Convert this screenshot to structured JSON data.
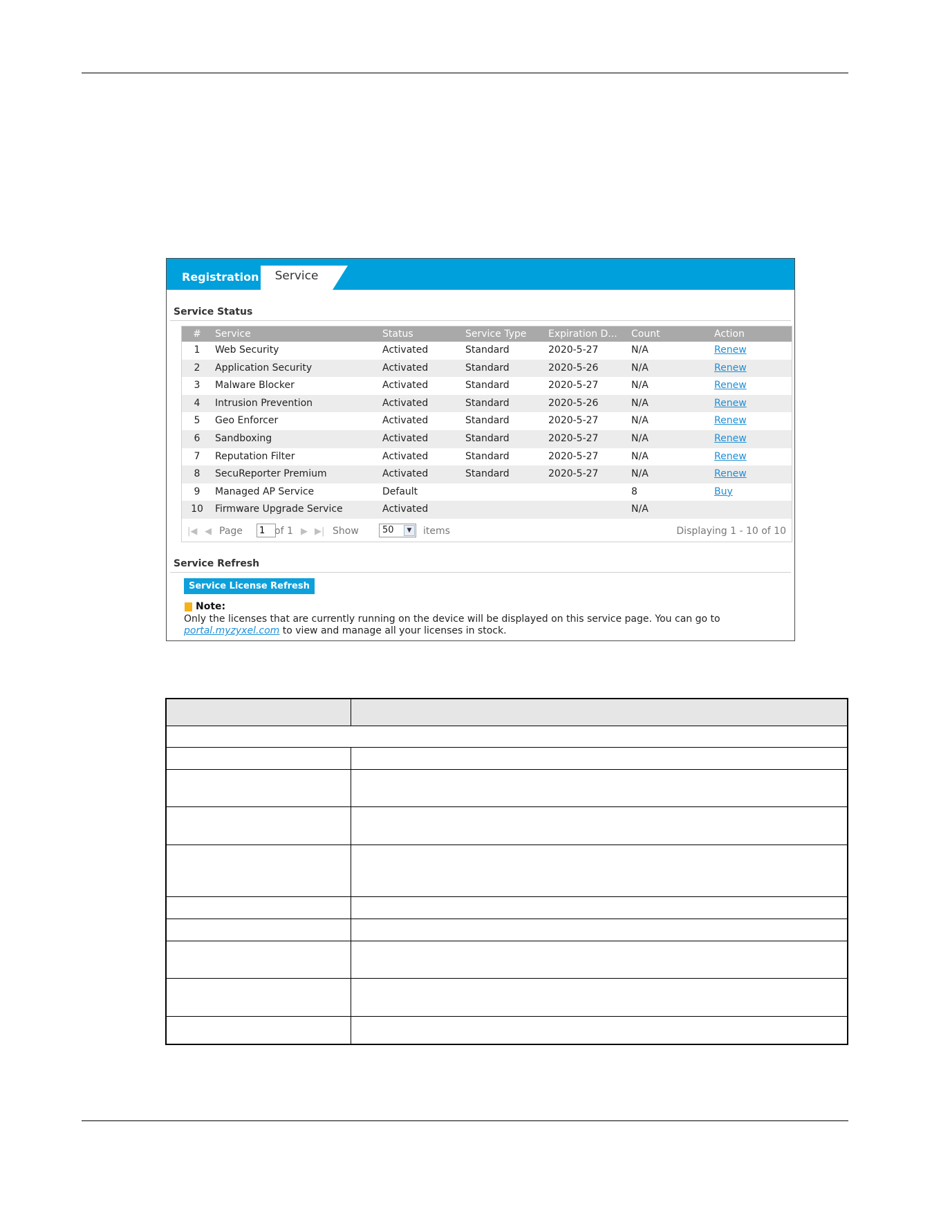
{
  "tabs": [
    {
      "label": "Registration"
    },
    {
      "label": "Service"
    }
  ],
  "service_status": {
    "title": "Service Status",
    "columns": [
      "#",
      "Service",
      "Status",
      "Service Type",
      "Expiration D...",
      "Count",
      "Action"
    ],
    "rows": [
      {
        "num": "1",
        "service": "Web Security",
        "status": "Activated",
        "type": "Standard",
        "expiration": "2020-5-27",
        "count": "N/A",
        "action": "Renew"
      },
      {
        "num": "2",
        "service": "Application Security",
        "status": "Activated",
        "type": "Standard",
        "expiration": "2020-5-26",
        "count": "N/A",
        "action": "Renew"
      },
      {
        "num": "3",
        "service": "Malware Blocker",
        "status": "Activated",
        "type": "Standard",
        "expiration": "2020-5-27",
        "count": "N/A",
        "action": "Renew"
      },
      {
        "num": "4",
        "service": "Intrusion Prevention",
        "status": "Activated",
        "type": "Standard",
        "expiration": "2020-5-26",
        "count": "N/A",
        "action": "Renew"
      },
      {
        "num": "5",
        "service": "Geo Enforcer",
        "status": "Activated",
        "type": "Standard",
        "expiration": "2020-5-27",
        "count": "N/A",
        "action": "Renew"
      },
      {
        "num": "6",
        "service": "Sandboxing",
        "status": "Activated",
        "type": "Standard",
        "expiration": "2020-5-27",
        "count": "N/A",
        "action": "Renew"
      },
      {
        "num": "7",
        "service": "Reputation Filter",
        "status": "Activated",
        "type": "Standard",
        "expiration": "2020-5-27",
        "count": "N/A",
        "action": "Renew"
      },
      {
        "num": "8",
        "service": "SecuReporter Premium",
        "status": "Activated",
        "type": "Standard",
        "expiration": "2020-5-27",
        "count": "N/A",
        "action": "Renew"
      },
      {
        "num": "9",
        "service": "Managed AP Service",
        "status": "Default",
        "type": "",
        "expiration": "",
        "count": "8",
        "action": "Buy"
      },
      {
        "num": "10",
        "service": "Firmware Upgrade Service",
        "status": "Activated",
        "type": "",
        "expiration": "",
        "count": "N/A",
        "action": ""
      }
    ],
    "pager": {
      "page_label": "Page",
      "page_value": "1",
      "of_label": "of 1",
      "show_label": "Show",
      "show_value": "50",
      "items_label": "items",
      "displaying": "Displaying 1 - 10 of 10"
    }
  },
  "service_refresh": {
    "title": "Service Refresh",
    "button_label": "Service License Refresh"
  },
  "note": {
    "title": "Note:",
    "text_before": "Only the licenses that are currently running on the device will be displayed on this service page. You can go to ",
    "link": "portal.myzyxel.com",
    "text_after": " to view and manage all your licenses in stock."
  },
  "icons": {
    "first": "first-page-icon",
    "prev": "prev-page-icon",
    "next": "next-page-icon",
    "last": "last-page-icon",
    "note": "note-icon",
    "dropdown": "chevron-down-icon"
  },
  "colors": {
    "tab_bar": "#00a0dc",
    "header_row": "#a9a9a9",
    "alt_row": "#ececec",
    "link": "#1e8fd6",
    "button": "#0ea0db"
  }
}
